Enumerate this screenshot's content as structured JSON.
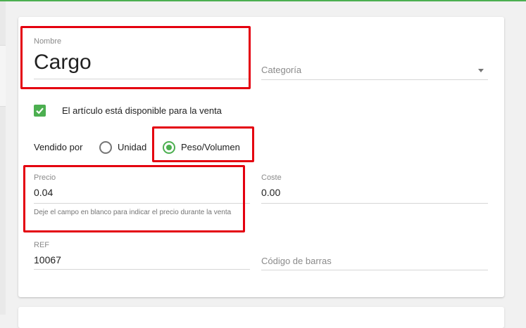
{
  "item_form": {
    "name": {
      "label": "Nombre",
      "value": "Cargo"
    },
    "category": {
      "placeholder": "Categoría"
    },
    "available_for_sale": {
      "label": "El artículo está disponible para la venta",
      "checked": true
    },
    "sold_by": {
      "label": "Vendido por",
      "options": [
        {
          "label": "Unidad",
          "selected": false
        },
        {
          "label": "Peso/Volumen",
          "selected": true
        }
      ]
    },
    "price": {
      "label": "Precio",
      "value": "0.04",
      "hint": "Deje el campo en blanco para indicar el precio durante la venta"
    },
    "cost": {
      "label": "Coste",
      "value": "0.00"
    },
    "ref": {
      "label": "REF",
      "value": "10067"
    },
    "barcode": {
      "placeholder": "Código de barras"
    }
  },
  "colors": {
    "accent": "#4caf50",
    "highlight": "#e4000f"
  }
}
